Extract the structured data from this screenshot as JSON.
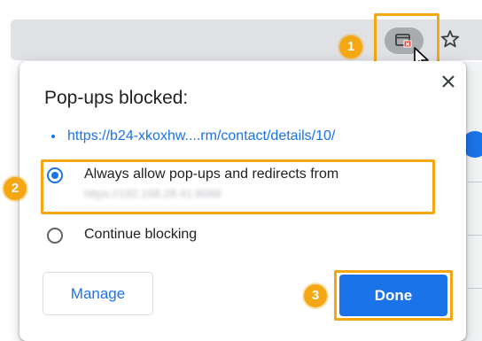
{
  "browser": {
    "popup_blocked_icon": "popup-blocked-icon",
    "bookmark_icon": "star-icon",
    "cursor_icon": "mouse-pointer-icon"
  },
  "dialog": {
    "title": "Pop-ups blocked:",
    "blocked_url": "https://b24-xkoxhw....rm/contact/details/10/",
    "option_allow_label": "Always allow pop-ups and redirects from",
    "option_allow_url": "https://192.168.28.41:8088",
    "option_allow_selected": true,
    "option_block_label": "Continue blocking",
    "option_block_selected": false,
    "manage_label": "Manage",
    "done_label": "Done",
    "close_icon": "close-icon"
  },
  "annotations": {
    "step1": "1",
    "step2": "2",
    "step3": "3",
    "highlight_color": "#f3a712"
  },
  "colors": {
    "accent": "#1a73e8",
    "toolbar": "#dfe1e5",
    "text": "#202124"
  }
}
